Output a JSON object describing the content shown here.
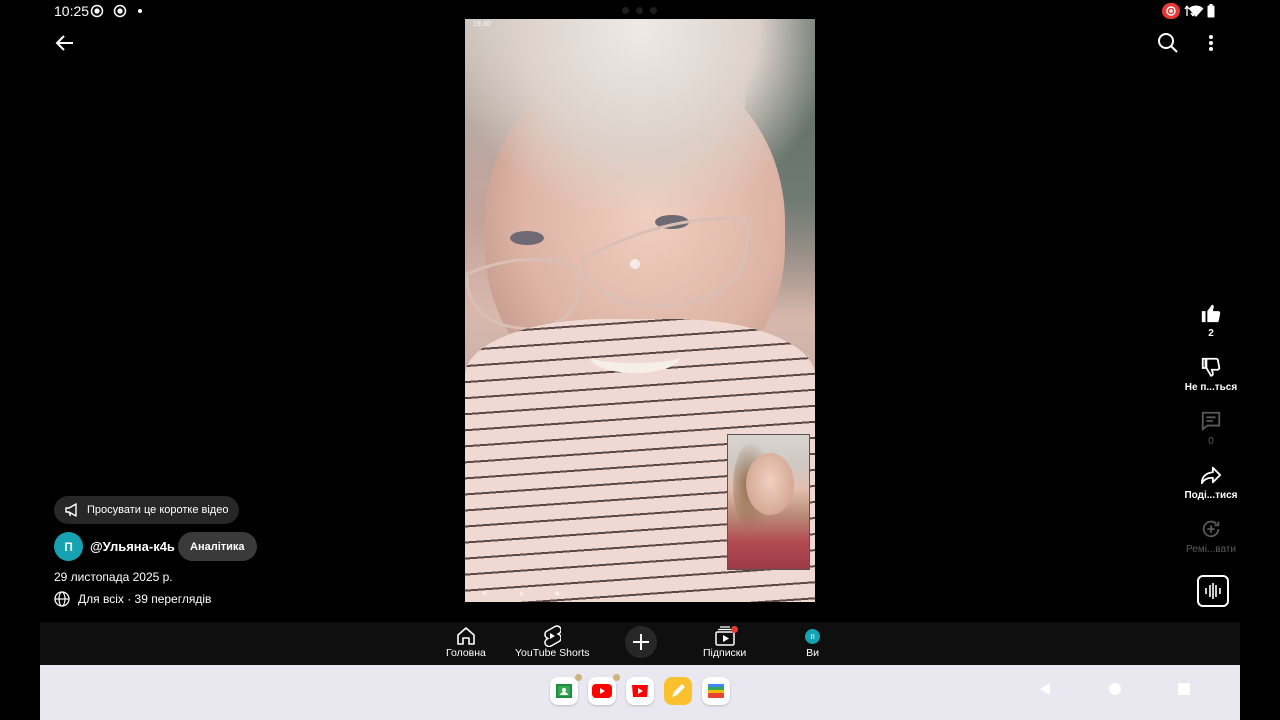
{
  "status_bar": {
    "time": "10:25"
  },
  "video": {
    "mini_status_time": "19:30"
  },
  "right_rail": {
    "like_count": "2",
    "dislike_label": "Не п...ться",
    "comment_count": "0",
    "share_label": "Поді...тися",
    "remix_label": "Ремі...вати"
  },
  "info": {
    "promote_label": "Просувати це коротке відео",
    "avatar_letter": "П",
    "handle": "@Ульяна-к4ь",
    "analytics_label": "Аналітика",
    "date": "29 листопада 2025 р.",
    "visibility": "Для всіх · 39 переглядів"
  },
  "bottom_nav": {
    "home": "Головна",
    "shorts": "YouTube Shorts",
    "subscriptions": "Підписки",
    "you": "Ви",
    "you_avatar_letter": "п"
  },
  "colors": {
    "avatar": "#17a2b4",
    "notification": "#e53935",
    "system_bar": "#e9e7ef"
  }
}
